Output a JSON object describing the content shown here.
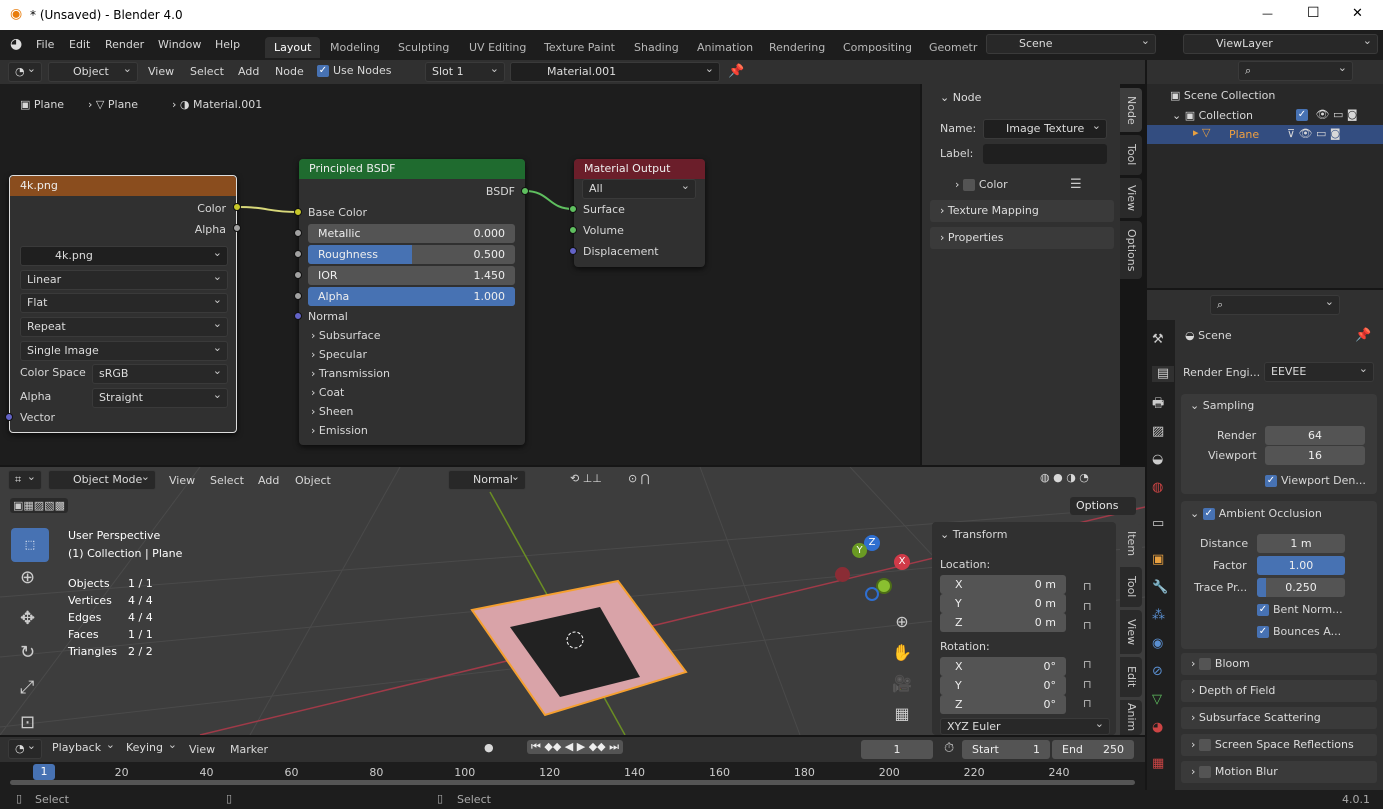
{
  "window": {
    "title": "* (Unsaved) - Blender 4.0",
    "minimize": "—",
    "maximize": "☐",
    "close": "✕"
  },
  "menu": [
    "File",
    "Edit",
    "Render",
    "Window",
    "Help"
  ],
  "workspaces": [
    "Layout",
    "Modeling",
    "Sculpting",
    "UV Editing",
    "Texture Paint",
    "Shading",
    "Animation",
    "Rendering",
    "Compositing",
    "Geometr"
  ],
  "scene": {
    "name": "Scene",
    "view_layer": "ViewLayer"
  },
  "node_header": {
    "mode": "Object",
    "menus": [
      "View",
      "Select",
      "Add",
      "Node"
    ],
    "use_nodes": "Use Nodes",
    "slot": "Slot 1",
    "material": "Material.001"
  },
  "breadcrumb": [
    "Plane",
    "Plane",
    "Material.001"
  ],
  "image_node": {
    "title": "4k.png",
    "out_color": "Color",
    "out_alpha": "Alpha",
    "image": "4k.png",
    "interpolation": "Linear",
    "projection": "Flat",
    "extension": "Repeat",
    "source": "Single Image",
    "color_space_label": "Color Space",
    "color_space": "sRGB",
    "alpha_label": "Alpha",
    "alpha": "Straight",
    "vector": "Vector"
  },
  "bsdf_node": {
    "title": "Principled BSDF",
    "out": "BSDF",
    "base_color": "Base Color",
    "fields": [
      {
        "label": "Metallic",
        "value": "0.000",
        "fill": 0
      },
      {
        "label": "Roughness",
        "value": "0.500",
        "fill": 0.5
      },
      {
        "label": "IOR",
        "value": "1.450",
        "fill": 0
      },
      {
        "label": "Alpha",
        "value": "1.000",
        "fill": 1
      }
    ],
    "normal": "Normal",
    "sections": [
      "Subsurface",
      "Specular",
      "Transmission",
      "Coat",
      "Sheen",
      "Emission"
    ]
  },
  "output_node": {
    "title": "Material Output",
    "target": "All",
    "inputs": [
      "Surface",
      "Volume",
      "Displacement"
    ]
  },
  "node_panel": {
    "title": "Node",
    "name_label": "Name:",
    "name": "Image Texture",
    "label_label": "Label:",
    "label": "",
    "color": "Color",
    "sections": [
      "Texture Mapping",
      "Properties"
    ],
    "tabs": [
      "Node",
      "Tool",
      "View",
      "Options"
    ]
  },
  "outliner": {
    "root": "Scene Collection",
    "collection": "Collection",
    "object": "Plane"
  },
  "properties": {
    "title": "Scene",
    "engine_label": "Render Engi...",
    "engine": "EEVEE",
    "sampling": "Sampling",
    "render_label": "Render",
    "render": "64",
    "viewport_label": "Viewport",
    "viewport": "16",
    "viewport_denoise": "Viewport Den...",
    "ao": "Ambient Occlusion",
    "distance_label": "Distance",
    "distance": "1 m",
    "factor_label": "Factor",
    "factor": "1.00",
    "trace_label": "Trace Pr...",
    "trace": "0.250",
    "trace_fill": 0.1,
    "bent": "Bent Norm...",
    "bounces": "Bounces A...",
    "sections": [
      "Bloom",
      "Depth of Field",
      "Subsurface Scattering",
      "Screen Space Reflections",
      "Motion Blur"
    ]
  },
  "viewport": {
    "mode": "Object Mode",
    "menus": [
      "View",
      "Select",
      "Add",
      "Object"
    ],
    "orientation": "Normal",
    "options": "Options",
    "perspective": "User Perspective",
    "collection": "(1) Collection | Plane",
    "stats": [
      [
        "Objects",
        "1 / 1"
      ],
      [
        "Vertices",
        "4 / 4"
      ],
      [
        "Edges",
        "4 / 4"
      ],
      [
        "Faces",
        "1 / 1"
      ],
      [
        "Triangles",
        "2 / 2"
      ]
    ],
    "tabs": [
      "Item",
      "Tool",
      "View",
      "Edit",
      "Anim"
    ],
    "transform": {
      "title": "Transform",
      "location": "Location:",
      "loc": [
        [
          "X",
          "0 m"
        ],
        [
          "Y",
          "0 m"
        ],
        [
          "Z",
          "0 m"
        ]
      ],
      "rotation": "Rotation:",
      "rot": [
        [
          "X",
          "0°"
        ],
        [
          "Y",
          "0°"
        ],
        [
          "Z",
          "0°"
        ]
      ],
      "euler": "XYZ Euler"
    },
    "gizmo": {
      "x": "X",
      "y": "Y",
      "z": "Z"
    }
  },
  "timeline": {
    "menus": [
      "Playback",
      "Keying",
      "View",
      "Marker"
    ],
    "frame": "1",
    "start_label": "Start",
    "start": "1",
    "end_label": "End",
    "end": "250",
    "current": "1",
    "ticks": [
      "20",
      "40",
      "60",
      "80",
      "100",
      "120",
      "140",
      "160",
      "180",
      "200",
      "220",
      "240"
    ]
  },
  "status": {
    "left": "Select",
    "mid": "Select",
    "version": "4.0.1"
  }
}
